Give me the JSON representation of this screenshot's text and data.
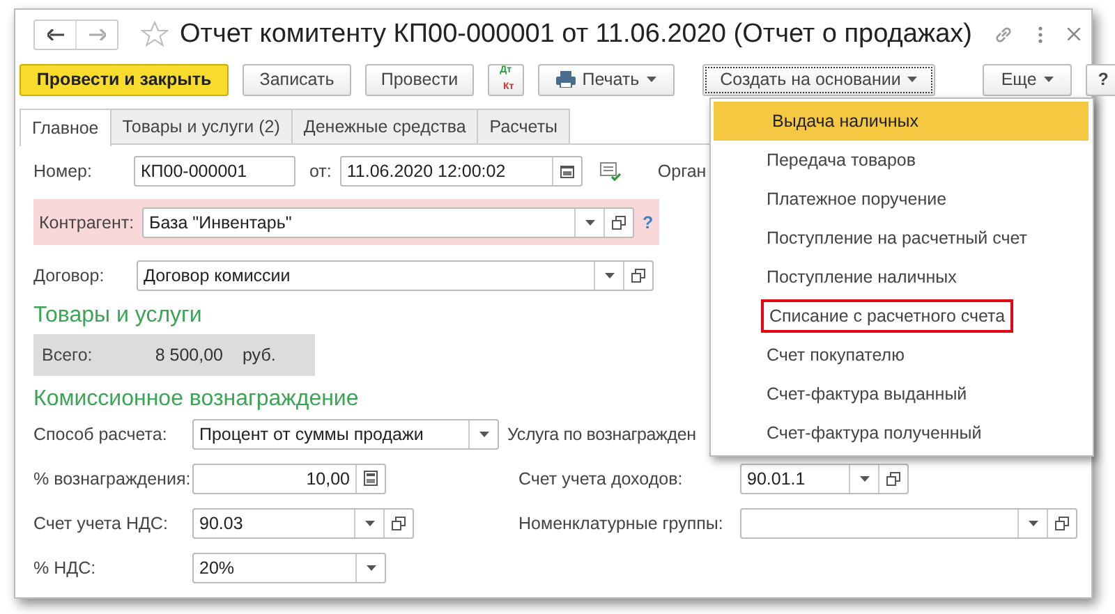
{
  "window": {
    "title": "Отчет комитенту КП00-000001 от 11.06.2020 (Отчет о продажах)"
  },
  "toolbar": [
    {
      "kind": "primary",
      "label": "Провести и закрыть"
    },
    {
      "kind": "plain",
      "label": "Записать"
    },
    {
      "kind": "plain",
      "label": "Провести"
    },
    {
      "kind": "dtkt",
      "label": "Дт",
      "label2": "Кт"
    },
    {
      "kind": "print",
      "label": "Печать"
    },
    {
      "kind": "focused",
      "label": "Создать на основании"
    },
    {
      "kind": "menu",
      "label": "Еще"
    },
    {
      "kind": "help",
      "label": "?"
    }
  ],
  "tabs": [
    {
      "label": "Главное",
      "selected": true
    },
    {
      "label": "Товары и услуги (2)",
      "selected": false
    },
    {
      "label": "Денежные средства",
      "selected": false
    },
    {
      "label": "Расчеты",
      "selected": false
    }
  ],
  "number": {
    "label": "Номер:",
    "value": "КП00-000001",
    "date_label": "от:",
    "date": "11.06.2020 12:00:02",
    "org_label": "Орган"
  },
  "counterparty": {
    "label": "Контрагент:",
    "value": "База \"Инвентарь\"",
    "error": true,
    "help": "?"
  },
  "contract": {
    "label": "Договор:",
    "value": "Договор комиссии"
  },
  "goods": {
    "heading": "Товары и услуги",
    "total_label": "Всего:",
    "total": "8 500,00",
    "currency": "руб."
  },
  "commission": {
    "heading": "Комиссионное вознаграждение",
    "method_label": "Способ расчета:",
    "method": "Процент от суммы продажи",
    "service_label": "Услуга по вознагражден",
    "percent_label": "% вознаграждения:",
    "percent": "10,00",
    "income_label": "Счет учета доходов:",
    "income": "90.01.1",
    "vat_account_label": "Счет учета НДС:",
    "vat_account": "90.03",
    "groups_label": "Номенклатурные группы:",
    "vat_label": "% НДС:",
    "vat": "20%"
  },
  "menu": [
    {
      "label": "Выдача наличных",
      "selected": true,
      "outlined": false
    },
    {
      "label": "Передача товаров",
      "selected": false,
      "outlined": false
    },
    {
      "label": "Платежное поручение",
      "selected": false,
      "outlined": false
    },
    {
      "label": "Поступление на расчетный счет",
      "selected": false,
      "outlined": false
    },
    {
      "label": "Поступление наличных",
      "selected": false,
      "outlined": false
    },
    {
      "label": "Списание с расчетного счета",
      "selected": false,
      "outlined": true
    },
    {
      "label": "Счет покупателю",
      "selected": false,
      "outlined": false
    },
    {
      "label": "Счет-фактура выданный",
      "selected": false,
      "outlined": false
    },
    {
      "label": "Счет-фактура полученный",
      "selected": false,
      "outlined": false
    }
  ]
}
